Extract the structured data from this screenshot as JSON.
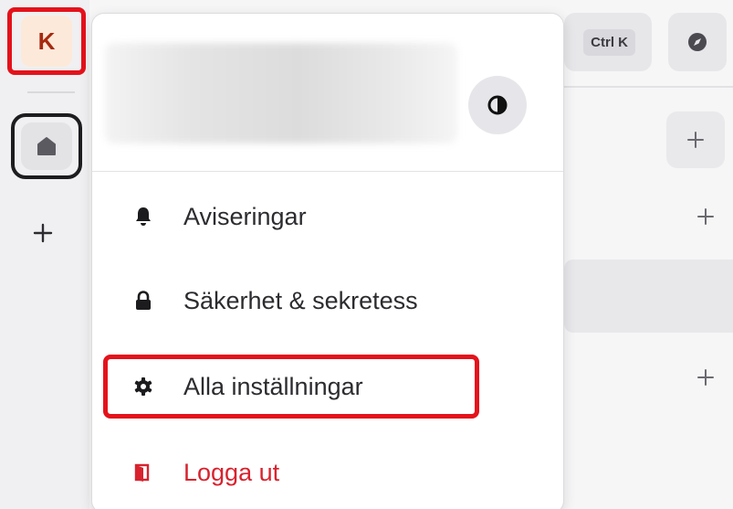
{
  "rail": {
    "avatar_letter": "K",
    "add_symbol": "+"
  },
  "topbar": {
    "shortcut_key": "Ctrl K"
  },
  "background": {
    "plus_symbol": "+"
  },
  "menu": {
    "items": [
      {
        "label": "Aviseringar",
        "icon": "bell-icon"
      },
      {
        "label": "Säkerhet & sekretess",
        "icon": "lock-icon"
      },
      {
        "label": "Alla inställningar",
        "icon": "gear-icon"
      },
      {
        "label": "Logga ut",
        "icon": "logout-icon"
      }
    ]
  },
  "colors": {
    "accent_red": "#e4121b",
    "logout_red": "#d8232e",
    "avatar_bg": "#fde9da",
    "avatar_text": "#a62a10"
  }
}
